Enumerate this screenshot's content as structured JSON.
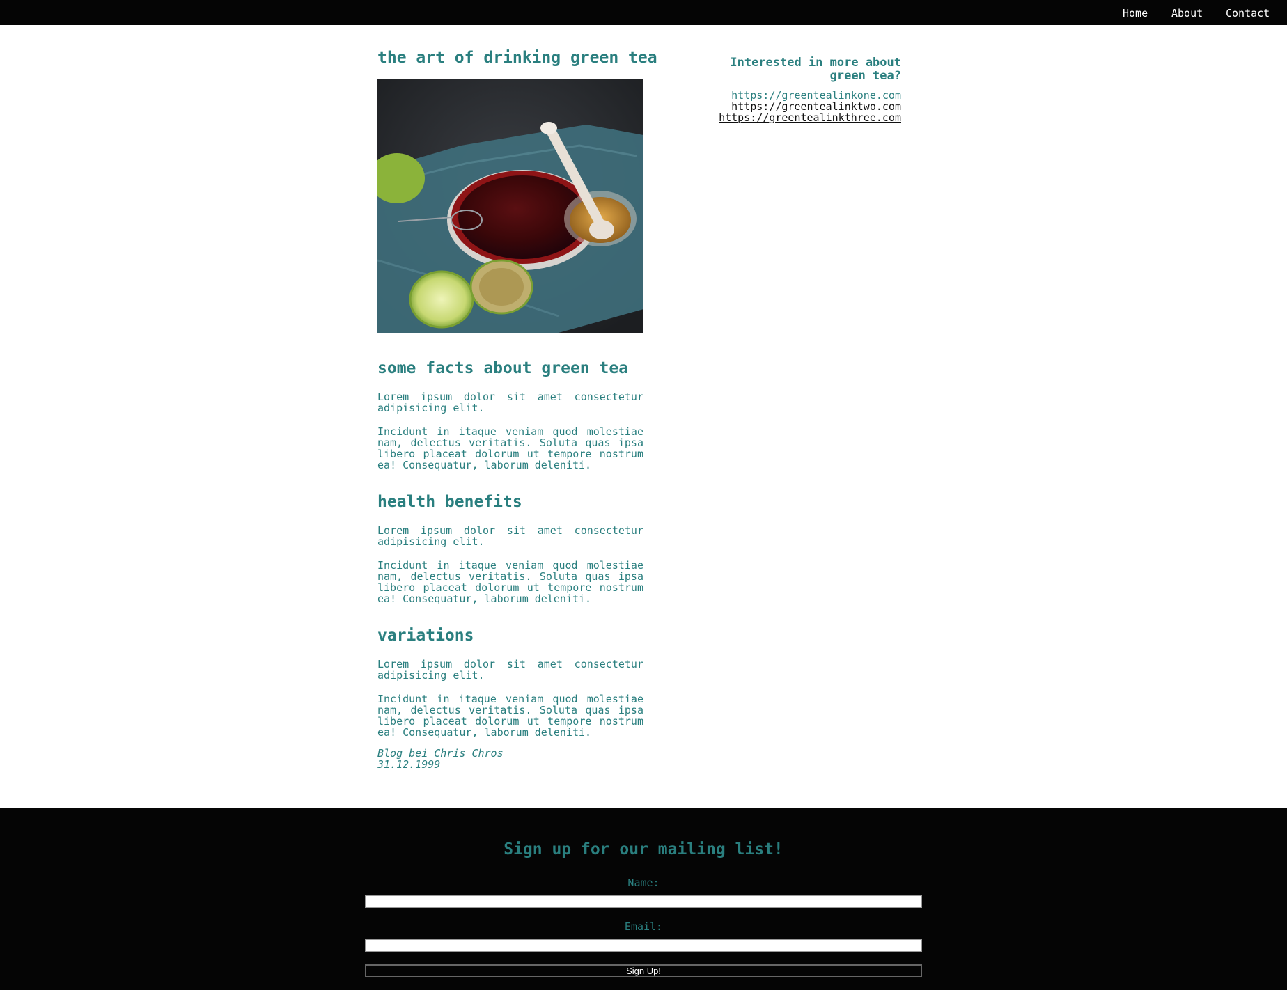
{
  "nav": {
    "home": "Home",
    "about": "About",
    "contact": "Contact"
  },
  "main": {
    "title": "the art of drinking green tea",
    "sections": [
      {
        "heading": "some facts about green tea",
        "p1": "Lorem ipsum dolor sit amet consectetur adipisicing elit.",
        "p2": "Incidunt in itaque veniam quod molestiae nam, delectus veritatis. Soluta quas ipsa libero placeat dolorum ut tempore nostrum ea! Consequatur, laborum deleniti."
      },
      {
        "heading": "health benefits",
        "p1": "Lorem ipsum dolor sit amet consectetur adipisicing elit.",
        "p2": "Incidunt in itaque veniam quod molestiae nam, delectus veritatis. Soluta quas ipsa libero placeat dolorum ut tempore nostrum ea! Consequatur, laborum deleniti."
      },
      {
        "heading": "variations",
        "p1": "Lorem ipsum dolor sit amet consectetur adipisicing elit.",
        "p2": "Incidunt in itaque veniam quod molestiae nam, delectus veritatis. Soluta quas ipsa libero placeat dolorum ut tempore nostrum ea! Consequatur, laborum deleniti."
      }
    ],
    "byline_author": "Blog bei Chris Chros",
    "byline_date": "31.12.1999"
  },
  "aside": {
    "heading": "Interested in more about green tea?",
    "links": [
      "https://greentealinkone.com",
      "https://greentealinktwo.com",
      "https://greentealinkthree.com"
    ]
  },
  "footer": {
    "heading": "Sign up for our mailing list!",
    "name_label": "Name:",
    "email_label": "Email:",
    "name_value": "",
    "email_value": "",
    "submit_label": "Sign Up!"
  },
  "colors": {
    "accent": "#2a7f7f",
    "dark": "#050505"
  }
}
